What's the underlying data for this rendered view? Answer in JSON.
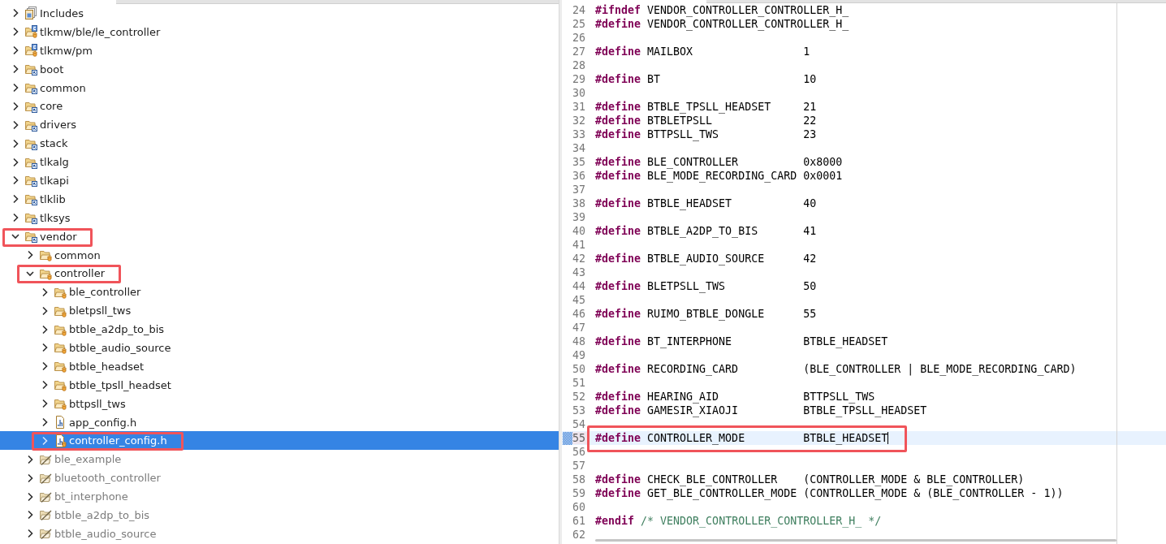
{
  "tree": {
    "items": [
      {
        "label": "Includes",
        "kind": "includes",
        "expanded": false,
        "selected": false,
        "highlighted": false
      },
      {
        "label": "tlkmw/ble/le_controller",
        "kind": "source",
        "expanded": false,
        "selected": false,
        "highlighted": false
      },
      {
        "label": "tlkmw/pm",
        "kind": "source",
        "expanded": false,
        "selected": false,
        "highlighted": false
      },
      {
        "label": "boot",
        "kind": "module",
        "expanded": false,
        "selected": false,
        "highlighted": false
      },
      {
        "label": "common",
        "kind": "module",
        "expanded": false,
        "selected": false,
        "highlighted": false
      },
      {
        "label": "core",
        "kind": "module",
        "expanded": false,
        "selected": false,
        "highlighted": false
      },
      {
        "label": "drivers",
        "kind": "module",
        "expanded": false,
        "selected": false,
        "highlighted": false
      },
      {
        "label": "stack",
        "kind": "module",
        "expanded": false,
        "selected": false,
        "highlighted": false
      },
      {
        "label": "tlkalg",
        "kind": "module",
        "expanded": false,
        "selected": false,
        "highlighted": false
      },
      {
        "label": "tlkapi",
        "kind": "module",
        "expanded": false,
        "selected": false,
        "highlighted": false
      },
      {
        "label": "tlklib",
        "kind": "module",
        "expanded": false,
        "selected": false,
        "highlighted": false
      },
      {
        "label": "tlksys",
        "kind": "module",
        "expanded": false,
        "selected": false,
        "highlighted": false
      },
      {
        "label": "vendor",
        "kind": "module",
        "expanded": true,
        "selected": false,
        "highlighted": true,
        "children": [
          {
            "label": "common",
            "kind": "folder",
            "expanded": false,
            "selected": false,
            "highlighted": false
          },
          {
            "label": "controller",
            "kind": "folder",
            "expanded": true,
            "selected": false,
            "highlighted": true,
            "children": [
              {
                "label": "ble_controller",
                "kind": "folder",
                "expanded": false,
                "selected": false,
                "highlighted": false
              },
              {
                "label": "bletpsll_tws",
                "kind": "folder",
                "expanded": false,
                "selected": false,
                "highlighted": false
              },
              {
                "label": "btble_a2dp_to_bis",
                "kind": "folder",
                "expanded": false,
                "selected": false,
                "highlighted": false
              },
              {
                "label": "btble_audio_source",
                "kind": "folder",
                "expanded": false,
                "selected": false,
                "highlighted": false
              },
              {
                "label": "btble_headset",
                "kind": "folder",
                "expanded": false,
                "selected": false,
                "highlighted": false
              },
              {
                "label": "btble_tpsll_headset",
                "kind": "folder",
                "expanded": false,
                "selected": false,
                "highlighted": false
              },
              {
                "label": "bttpsll_tws",
                "kind": "folder",
                "expanded": false,
                "selected": false,
                "highlighted": false
              },
              {
                "label": "app_config.h",
                "kind": "header",
                "expanded": false,
                "selected": false,
                "highlighted": false
              },
              {
                "label": "controller_config.h",
                "kind": "linkedheader",
                "expanded": false,
                "selected": true,
                "highlighted": true
              }
            ]
          },
          {
            "label": "ble_example",
            "kind": "excluded",
            "expanded": false,
            "selected": false,
            "highlighted": false
          },
          {
            "label": "bluetooth_controller",
            "kind": "excluded",
            "expanded": false,
            "selected": false,
            "highlighted": false
          },
          {
            "label": "bt_interphone",
            "kind": "excluded",
            "expanded": false,
            "selected": false,
            "highlighted": false
          },
          {
            "label": "btble_a2dp_to_bis",
            "kind": "excluded",
            "expanded": false,
            "selected": false,
            "highlighted": false
          },
          {
            "label": "btble_audio_source",
            "kind": "excluded",
            "expanded": false,
            "selected": false,
            "highlighted": false
          }
        ]
      }
    ]
  },
  "editor": {
    "lines": [
      {
        "number": "24",
        "directive": "#ifndef",
        "text": "VENDOR_CONTROLLER_CONTROLLER_H_",
        "current": false,
        "highlighted": false
      },
      {
        "number": "25",
        "directive": "#define",
        "text": "VENDOR_CONTROLLER_CONTROLLER_H_",
        "current": false,
        "highlighted": false
      },
      {
        "number": "26",
        "current": false,
        "highlighted": false
      },
      {
        "number": "27",
        "directive": "#define",
        "text": "MAILBOX                 1",
        "current": false,
        "highlighted": false
      },
      {
        "number": "28",
        "current": false,
        "highlighted": false
      },
      {
        "number": "29",
        "directive": "#define",
        "text": "BT                      10",
        "current": false,
        "highlighted": false
      },
      {
        "number": "30",
        "current": false,
        "highlighted": false
      },
      {
        "number": "31",
        "directive": "#define",
        "text": "BTBLE_TPSLL_HEADSET     21",
        "current": false,
        "highlighted": false
      },
      {
        "number": "32",
        "directive": "#define",
        "text": "BTBLETPSLL              22",
        "current": false,
        "highlighted": false
      },
      {
        "number": "33",
        "directive": "#define",
        "text": "BTTPSLL_TWS             23",
        "current": false,
        "highlighted": false
      },
      {
        "number": "34",
        "current": false,
        "highlighted": false
      },
      {
        "number": "35",
        "directive": "#define",
        "text": "BLE_CONTROLLER          0x8000",
        "current": false,
        "highlighted": false
      },
      {
        "number": "36",
        "directive": "#define",
        "text": "BLE_MODE_RECORDING_CARD 0x0001",
        "current": false,
        "highlighted": false
      },
      {
        "number": "37",
        "current": false,
        "highlighted": false
      },
      {
        "number": "38",
        "directive": "#define",
        "text": "BTBLE_HEADSET           40",
        "current": false,
        "highlighted": false
      },
      {
        "number": "39",
        "current": false,
        "highlighted": false
      },
      {
        "number": "40",
        "directive": "#define",
        "text": "BTBLE_A2DP_TO_BIS       41",
        "current": false,
        "highlighted": false
      },
      {
        "number": "41",
        "current": false,
        "highlighted": false
      },
      {
        "number": "42",
        "directive": "#define",
        "text": "BTBLE_AUDIO_SOURCE      42",
        "current": false,
        "highlighted": false
      },
      {
        "number": "43",
        "current": false,
        "highlighted": false
      },
      {
        "number": "44",
        "directive": "#define",
        "text": "BLETPSLL_TWS            50",
        "current": false,
        "highlighted": false
      },
      {
        "number": "45",
        "current": false,
        "highlighted": false
      },
      {
        "number": "46",
        "directive": "#define",
        "text": "RUIMO_BTBLE_DONGLE      55",
        "current": false,
        "highlighted": false
      },
      {
        "number": "47",
        "current": false,
        "highlighted": false
      },
      {
        "number": "48",
        "directive": "#define",
        "text": "BT_INTERPHONE           BTBLE_HEADSET",
        "current": false,
        "highlighted": false
      },
      {
        "number": "49",
        "current": false,
        "highlighted": false
      },
      {
        "number": "50",
        "directive": "#define",
        "text": "RECORDING_CARD          (BLE_CONTROLLER | BLE_MODE_RECORDING_CARD)",
        "current": false,
        "highlighted": false
      },
      {
        "number": "51",
        "current": false,
        "highlighted": false
      },
      {
        "number": "52",
        "directive": "#define",
        "text": "HEARING_AID             BTTPSLL_TWS",
        "current": false,
        "highlighted": false
      },
      {
        "number": "53",
        "directive": "#define",
        "text": "GAMESIR_XIAOJI          BTBLE_TPSLL_HEADSET",
        "current": false,
        "highlighted": false
      },
      {
        "number": "54",
        "current": false,
        "highlighted": false
      },
      {
        "number": "55",
        "directive": "#define",
        "text": "CONTROLLER_MODE         BTBLE_HEADSET",
        "current": true,
        "highlighted": true
      },
      {
        "number": "56",
        "current": false,
        "highlighted": false
      },
      {
        "number": "57",
        "current": false,
        "highlighted": false
      },
      {
        "number": "58",
        "directive": "#define",
        "text": "CHECK_BLE_CONTROLLER    (CONTROLLER_MODE & BLE_CONTROLLER)",
        "current": false,
        "highlighted": false
      },
      {
        "number": "59",
        "directive": "#define",
        "text": "GET_BLE_CONTROLLER_MODE (CONTROLLER_MODE & (BLE_CONTROLLER - 1))",
        "current": false,
        "highlighted": false
      },
      {
        "number": "60",
        "current": false,
        "highlighted": false
      },
      {
        "number": "61",
        "directive": "#endif",
        "comment": "/* VENDOR_CONTROLLER_CONTROLLER_H_ */",
        "current": false,
        "highlighted": false
      },
      {
        "number": "62",
        "current": false,
        "highlighted": false
      }
    ]
  }
}
